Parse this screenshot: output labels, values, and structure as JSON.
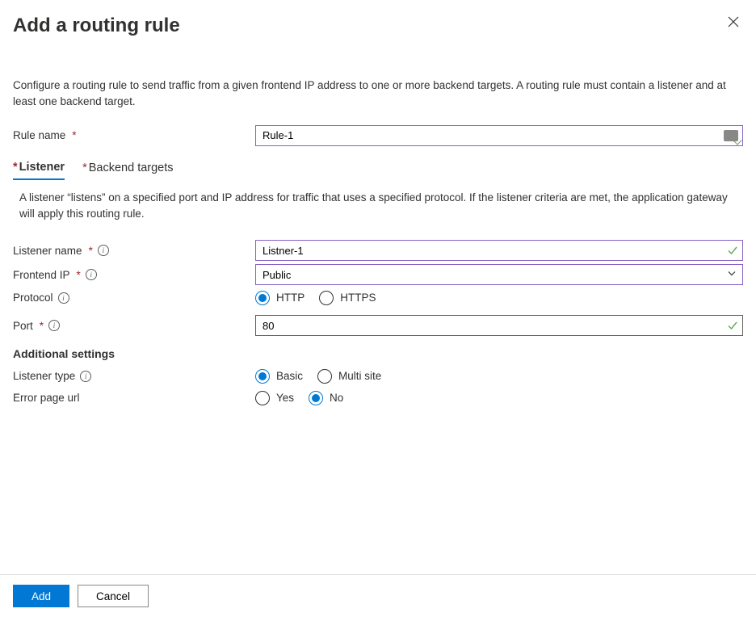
{
  "title": "Add a routing rule",
  "description": "Configure a routing rule to send traffic from a given frontend IP address to one or more backend targets. A routing rule must contain a listener and at least one backend target.",
  "rule_name": {
    "label": "Rule name",
    "value": "Rule-1"
  },
  "tabs": {
    "listener": "Listener",
    "backend": "Backend targets"
  },
  "listener_desc": "A listener “listens” on a specified port and IP address for traffic that uses a specified protocol. If the listener criteria are met, the application gateway will apply this routing rule.",
  "listener": {
    "name_label": "Listener name",
    "name_value": "Listner-1",
    "frontend_label": "Frontend IP",
    "frontend_value": "Public",
    "protocol_label": "Protocol",
    "protocol_options": {
      "http": "HTTP",
      "https": "HTTPS"
    },
    "port_label": "Port",
    "port_value": "80"
  },
  "additional": {
    "heading": "Additional settings",
    "listener_type_label": "Listener type",
    "listener_type_options": {
      "basic": "Basic",
      "multi": "Multi site"
    },
    "error_page_label": "Error page url",
    "error_page_options": {
      "yes": "Yes",
      "no": "No"
    }
  },
  "footer": {
    "add": "Add",
    "cancel": "Cancel"
  }
}
